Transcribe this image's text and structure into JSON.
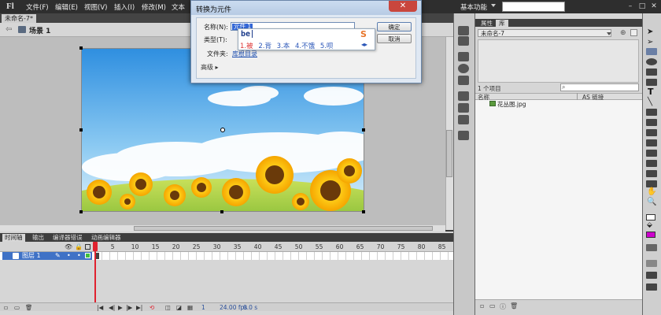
{
  "app": {
    "logo": "Fl"
  },
  "menubar": {
    "items": [
      "文件(F)",
      "编辑(E)",
      "视图(V)",
      "插入(I)",
      "修改(M)",
      "文本"
    ],
    "workspace": "基本功能",
    "window_controls": [
      "–",
      "□",
      "✕"
    ]
  },
  "document": {
    "tab_title": "未命名-7*"
  },
  "scene": {
    "label": "场景 1"
  },
  "timeline": {
    "tabs": [
      "时间轴",
      "输出",
      "编译器错误",
      "动画编辑器"
    ],
    "active_tab": "时间轴",
    "frame_numbers": [
      "1",
      "5",
      "10",
      "15",
      "20",
      "25",
      "30",
      "35",
      "40",
      "45",
      "50",
      "55",
      "60",
      "65",
      "70",
      "75",
      "80",
      "85"
    ],
    "layer_name": "图层 1",
    "status": {
      "frame": "1",
      "fps": "24.00 fps",
      "time": "0.0 s"
    }
  },
  "library": {
    "tabs": [
      "属性",
      "库"
    ],
    "active_tab": "库",
    "doc_select": "未命名-7",
    "count_text": "1 个项目",
    "columns": {
      "name": "名称",
      "linkage": "AS 链接"
    },
    "items": [
      {
        "name": "花丛图.jpg"
      }
    ]
  },
  "dialog": {
    "title": "转换为元件",
    "close": "✕",
    "name_label": "名称(N):",
    "name_value": "元件 1",
    "type_label": "类型(T):",
    "folder_label": "文件夹:",
    "folder_value": "库根目录",
    "advanced": "高级 ▸",
    "ok": "确定",
    "cancel": "取消"
  },
  "ime": {
    "input": "be",
    "logo": "S",
    "candidates": [
      "1.被",
      "2.背",
      "3.本",
      "4.不饿",
      "5.呗"
    ],
    "nav": "◂▸"
  },
  "colors": {
    "accent": "#3f72c6",
    "playhead": "#e0222f",
    "fill_swatch": "#cc00cc"
  }
}
